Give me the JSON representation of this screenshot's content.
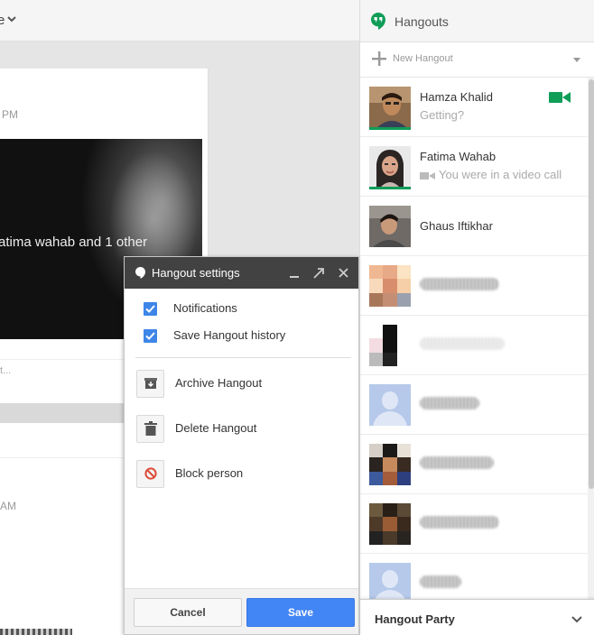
{
  "background": {
    "post_time_partial": "PM",
    "photo_caption": "atima wahab and 1 other",
    "comment_placeholder_partial": "t...",
    "second_post_time_partial": "AM"
  },
  "hangouts": {
    "title": "Hangouts",
    "new_hangout_label": "New Hangout",
    "colors": {
      "accent": "#0f9d58",
      "video": "#0f9d58"
    },
    "contacts": [
      {
        "name": "Hamza Khalid",
        "status": "Getting?",
        "online": true,
        "video_icon": "video-camera-icon"
      },
      {
        "name": "Fatima Wahab",
        "status": "You were in a video call",
        "online": true,
        "status_icon": "video-camera-icon"
      },
      {
        "name": "Ghaus Iftikhar",
        "status": "",
        "online": false
      }
    ],
    "footer_label": "Hangout Party"
  },
  "dialog": {
    "title": "Hangout settings",
    "checkboxes": [
      {
        "label": "Notifications",
        "checked": true
      },
      {
        "label": "Save Hangout history",
        "checked": true
      }
    ],
    "actions": [
      {
        "label": "Archive Hangout",
        "icon": "archive-icon"
      },
      {
        "label": "Delete Hangout",
        "icon": "trash-icon"
      },
      {
        "label": "Block person",
        "icon": "block-icon"
      }
    ],
    "cancel_label": "Cancel",
    "save_label": "Save",
    "colors": {
      "header": "#424242",
      "primary": "#4285f4",
      "checkbox": "#3d86e8",
      "block": "#dd4b39"
    }
  }
}
